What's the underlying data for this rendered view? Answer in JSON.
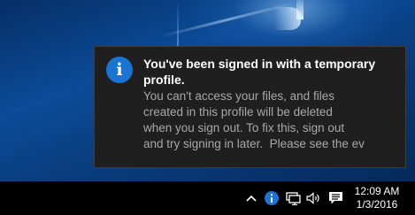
{
  "notification": {
    "icon": "info-icon",
    "title": "You've been signed in with a temporary profile.",
    "message_lines": [
      "You can't access your files, and files",
      "created in this profile will be deleted",
      "when you sign out. To fix this, sign out",
      "and try signing in later.  Please see the ev"
    ],
    "colors": {
      "background": "#1f1f1f",
      "title": "#ffffff",
      "message": "#a8a8a8",
      "icon_accent": "#1a74d4"
    }
  },
  "taskbar": {
    "tray_icons": [
      "chevron-up-icon",
      "info-icon",
      "network-icon",
      "volume-icon",
      "action-center-icon"
    ],
    "time": "12:09 AM",
    "date": "1/3/2016"
  }
}
